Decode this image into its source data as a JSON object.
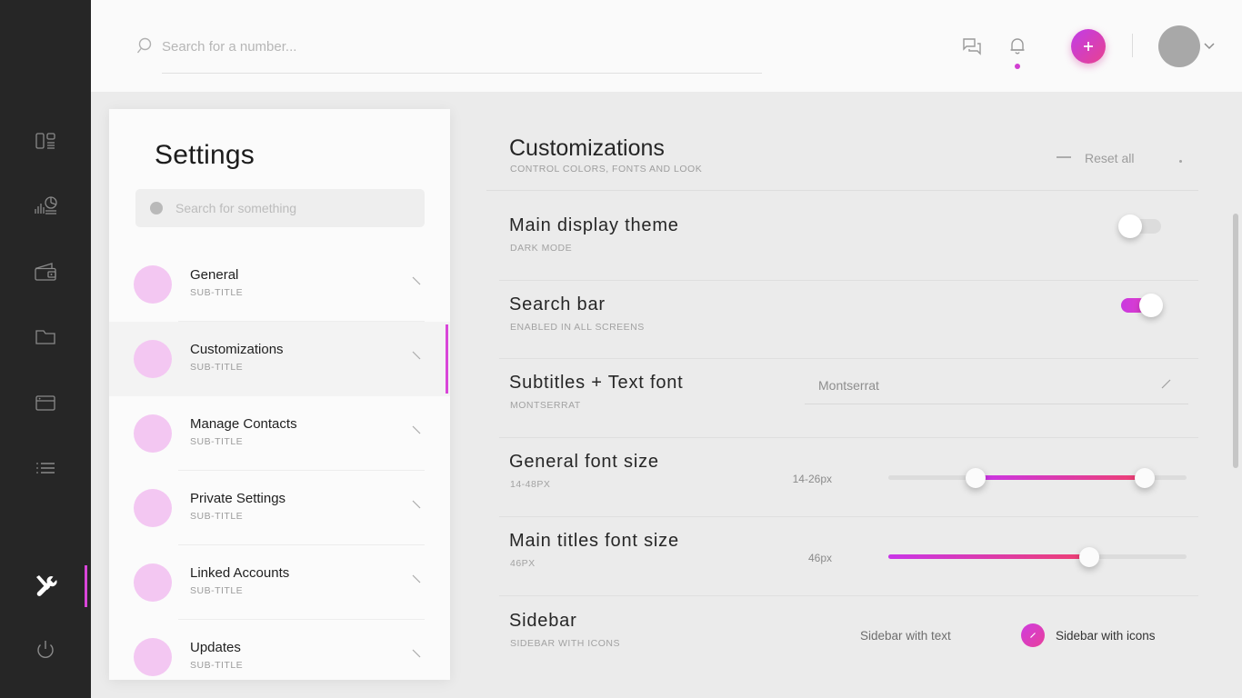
{
  "rail": {
    "items": [
      {
        "name": "dashboard",
        "active": false
      },
      {
        "name": "analytics",
        "active": false
      },
      {
        "name": "wallet",
        "active": false
      },
      {
        "name": "folder",
        "active": false
      },
      {
        "name": "window",
        "active": false
      },
      {
        "name": "list",
        "active": false
      },
      {
        "name": "tools",
        "active": true
      },
      {
        "name": "power",
        "active": false
      }
    ],
    "active_indicator_color": "#d946d9"
  },
  "topbar": {
    "search_placeholder": "Search for a number...",
    "search_value": "",
    "icons": {
      "search": "search-icon",
      "chat": "chat-icon",
      "bell": "bell-icon",
      "add": "plus-icon",
      "chevron": "chevron-down-icon"
    },
    "add_button_label": "+",
    "notification_dot_color": "#d13fd1",
    "accent_gradient": "linear-gradient(135deg,#c13ce8,#e8428f)"
  },
  "settings_panel": {
    "title": "Settings",
    "search_placeholder": "Search for something",
    "search_value": "",
    "items": [
      {
        "label": "General",
        "sub": "SUB-TITLE",
        "active": false
      },
      {
        "label": "Customizations",
        "sub": "SUB-TITLE",
        "active": true
      },
      {
        "label": "Manage Contacts",
        "sub": "SUB-TITLE",
        "active": false
      },
      {
        "label": "Private Settings",
        "sub": "SUB-TITLE",
        "active": false
      },
      {
        "label": "Linked Accounts",
        "sub": "SUB-TITLE",
        "active": false
      },
      {
        "label": "Updates",
        "sub": "SUB-TITLE",
        "active": false
      }
    ]
  },
  "content": {
    "title": "Customizations",
    "subtitle": "CONTROL COLORS, FONTS AND LOOK",
    "reset_label": "Reset all",
    "rows": {
      "theme": {
        "title": "Main display theme",
        "sub": "DARK MODE",
        "toggle_state": "off"
      },
      "search_bar": {
        "title": "Search bar",
        "sub": "ENABLED IN ALL SCREENS",
        "toggle_state": "on"
      },
      "text_font": {
        "title": "Subtitles + Text font",
        "sub": "MONTSERRAT",
        "value": "Montserrat"
      },
      "general_font_size": {
        "title": "General font size",
        "sub": "14-48PX",
        "value_label": "14-26px",
        "range": [
          14,
          48
        ],
        "selected": [
          14,
          26
        ]
      },
      "main_titles_font_size": {
        "title": "Main titles font size",
        "sub": "46PX",
        "value_label": "46px",
        "range": [
          14,
          48
        ],
        "selected": 46
      },
      "sidebar": {
        "title": "Sidebar",
        "sub": "SIDEBAR WITH ICONS",
        "option_text": "Sidebar with text",
        "option_icons": "Sidebar with icons",
        "selected": "Sidebar with icons"
      }
    }
  }
}
